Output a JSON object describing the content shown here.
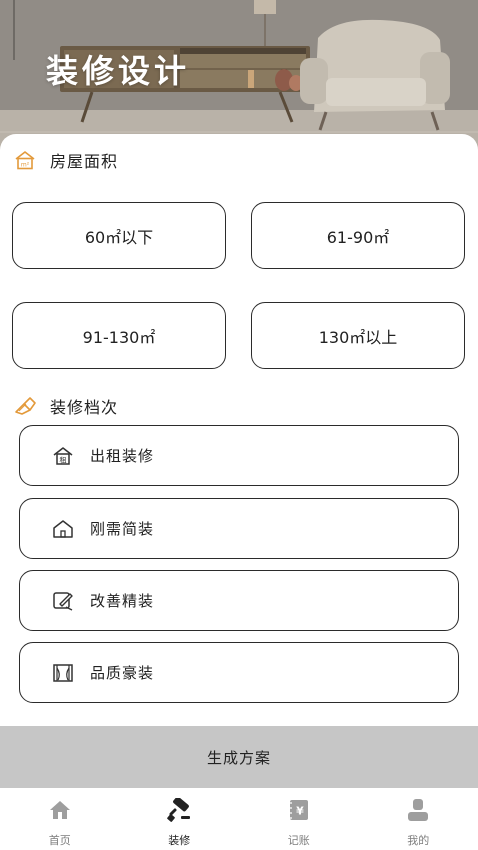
{
  "header": {
    "title": "装修设计"
  },
  "area_section": {
    "label": "房屋面积",
    "icon": "house-area-icon",
    "icon_text": "m²",
    "options": [
      "60㎡以下",
      "61-90㎡",
      "91-130㎡",
      "130㎡以上"
    ]
  },
  "level_section": {
    "label": "装修档次",
    "icon": "paint-brush-icon",
    "options": [
      {
        "label": "出租装修",
        "icon": "rent-house-icon",
        "icon_text": "租"
      },
      {
        "label": "刚需简装",
        "icon": "house-outline-icon"
      },
      {
        "label": "改善精装",
        "icon": "pencil-edit-icon"
      },
      {
        "label": "品质豪装",
        "icon": "window-frame-icon"
      }
    ]
  },
  "action": {
    "generate_label": "生成方案"
  },
  "tabbar": {
    "items": [
      {
        "label": "首页",
        "icon": "home-icon",
        "active": false
      },
      {
        "label": "装修",
        "icon": "paint-roller-icon",
        "active": true
      },
      {
        "label": "记账",
        "icon": "ledger-yen-icon",
        "icon_text": "¥",
        "active": false
      },
      {
        "label": "我的",
        "icon": "user-icon",
        "active": false
      }
    ]
  },
  "colors": {
    "accent": "#e39a3b",
    "button_border": "#2b2b2b",
    "generate_bg": "#c6c6c6",
    "tab_inactive": "#9e9e9e",
    "tab_active": "#222222"
  }
}
